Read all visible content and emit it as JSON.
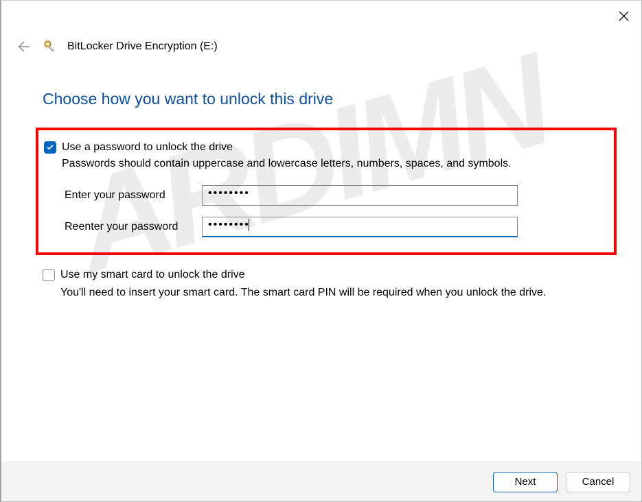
{
  "window": {
    "title": "BitLocker Drive Encryption (E:)"
  },
  "page": {
    "heading": "Choose how you want to unlock this drive"
  },
  "password_option": {
    "label": "Use a password to unlock the drive",
    "checked": true,
    "hint": "Passwords should contain uppercase and lowercase letters, numbers, spaces, and symbols.",
    "enter_label": "Enter your password",
    "reenter_label": "Reenter your password",
    "enter_value": "••••••••",
    "reenter_value": "••••••••"
  },
  "smartcard_option": {
    "label": "Use my smart card to unlock the drive",
    "checked": false,
    "hint": "You'll need to insert your smart card. The smart card PIN will be required when you unlock the drive."
  },
  "footer": {
    "next": "Next",
    "cancel": "Cancel"
  }
}
